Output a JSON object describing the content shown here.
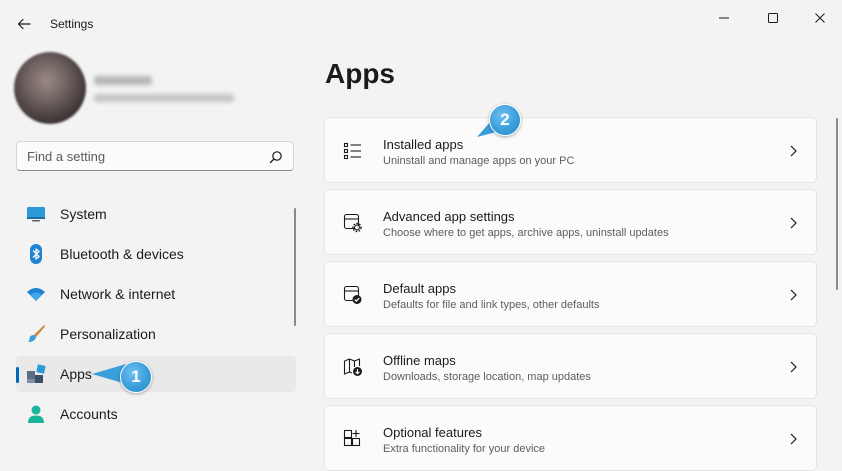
{
  "window": {
    "title": "Settings",
    "controls": {
      "minimize": "minimize-icon",
      "maximize": "maximize-icon",
      "close": "close-icon"
    }
  },
  "search": {
    "placeholder": "Find a setting",
    "value": ""
  },
  "sidebar": {
    "items": [
      {
        "label": "System",
        "icon": "monitor-icon"
      },
      {
        "label": "Bluetooth & devices",
        "icon": "bluetooth-icon"
      },
      {
        "label": "Network & internet",
        "icon": "wifi-icon"
      },
      {
        "label": "Personalization",
        "icon": "brush-icon"
      },
      {
        "label": "Apps",
        "icon": "apps-icon",
        "selected": true
      },
      {
        "label": "Accounts",
        "icon": "person-icon"
      }
    ]
  },
  "main": {
    "title": "Apps",
    "cards": [
      {
        "title": "Installed apps",
        "subtitle": "Uninstall and manage apps on your PC",
        "icon": "list-icon"
      },
      {
        "title": "Advanced app settings",
        "subtitle": "Choose where to get apps, archive apps, uninstall updates",
        "icon": "app-gear-icon"
      },
      {
        "title": "Default apps",
        "subtitle": "Defaults for file and link types, other defaults",
        "icon": "default-apps-icon"
      },
      {
        "title": "Offline maps",
        "subtitle": "Downloads, storage location, map updates",
        "icon": "map-download-icon"
      },
      {
        "title": "Optional features",
        "subtitle": "Extra functionality for your device",
        "icon": "add-feature-icon"
      }
    ]
  },
  "callouts": [
    {
      "number": "1"
    },
    {
      "number": "2"
    }
  ],
  "colors": {
    "accent": "#0067c0",
    "callout": "#3a9edb",
    "background": "#f3f3f3",
    "card": "#fbfbfb"
  }
}
